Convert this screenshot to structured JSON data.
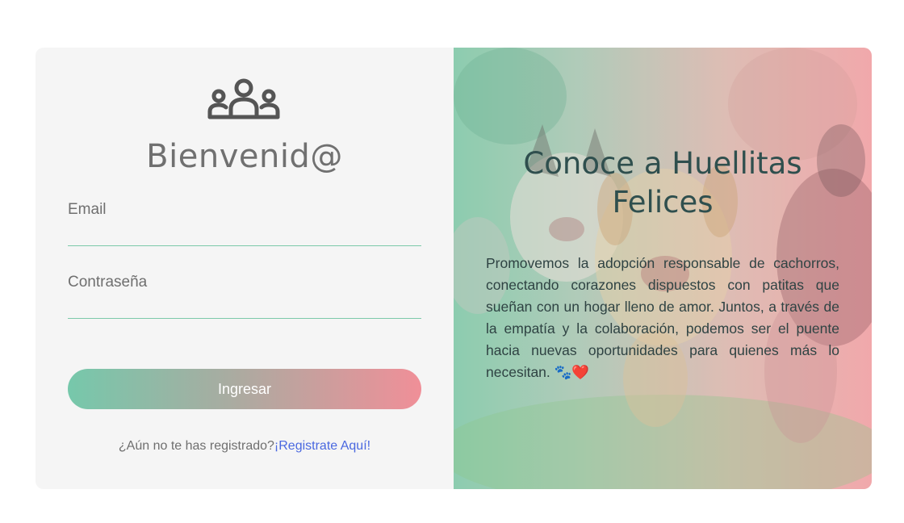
{
  "login": {
    "welcome": "Bienvenid@",
    "email_label": "Email",
    "email_value": "",
    "password_label": "Contraseña",
    "password_value": "",
    "submit_label": "Ingresar",
    "register_prompt": "¿Aún no te has registrado?",
    "register_link": "¡Registrate Aquí!",
    "icon": "users-group-icon"
  },
  "promo": {
    "title": "Conoce a Huellitas Felices",
    "text": "Promovemos la adopción responsable de cachorros, conectando corazones dispuestos con patitas que sueñan con un hogar lleno de amor. Juntos, a través de la empatía y la colaboración, podemos ser el puente hacia nuevas oportunidades para quienes más lo necesitan. 🐾❤️",
    "background": "dogs-and-cat-running-photo"
  },
  "colors": {
    "accent_green": "#76c8ab",
    "accent_pink": "#f08f98",
    "link_blue": "#4a68e0"
  }
}
